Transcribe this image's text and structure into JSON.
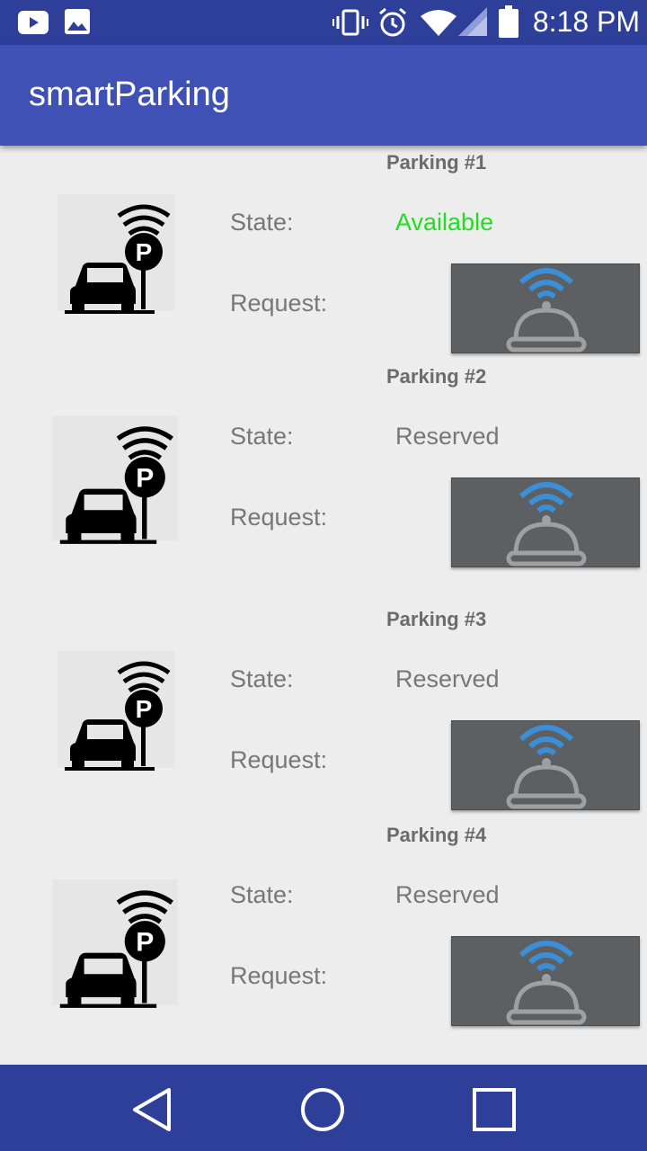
{
  "status_bar": {
    "time": "8:18 PM",
    "icons": [
      "youtube-icon",
      "gallery-icon",
      "vibrate-icon",
      "alarm-icon",
      "wifi-icon",
      "cell-signal-icon",
      "battery-icon"
    ]
  },
  "app_bar": {
    "title": "smartParking"
  },
  "parkings": [
    {
      "title": "Parking #1",
      "state_label": "State:",
      "state": "Available",
      "request_label": "Request:"
    },
    {
      "title": "Parking #2",
      "state_label": "State:",
      "state": "Reserved",
      "request_label": "Request:"
    },
    {
      "title": "Parking #3",
      "state_label": "State:",
      "state": "Reserved",
      "request_label": "Request:"
    },
    {
      "title": "Parking #4",
      "state_label": "State:",
      "state": "Reserved",
      "request_label": "Request:"
    }
  ],
  "icons": {
    "parking": "smart-parking-icon",
    "request": "service-bell-icon"
  },
  "colors": {
    "status_bar": "#2e3f99",
    "app_bar": "#3f51b5",
    "available": "#22dd22",
    "reserved": "#777777",
    "request_button": "#5d6062",
    "bell_signal": "#3a8fd6"
  },
  "nav_bar": {
    "buttons": [
      "back",
      "home",
      "recents"
    ]
  }
}
